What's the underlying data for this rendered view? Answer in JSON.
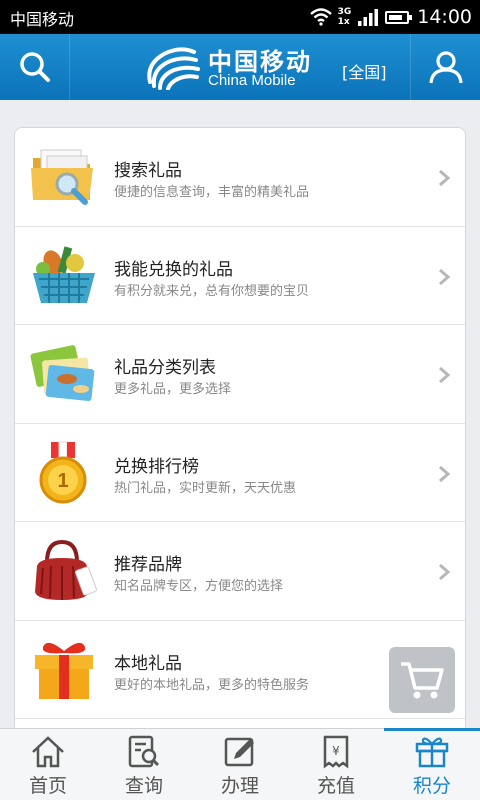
{
  "status": {
    "carrier": "中国移动",
    "network_top": "3G",
    "network_bottom": "1x",
    "battery_level": 0.8,
    "time": "14:00"
  },
  "header": {
    "logo_cn": "中国移动",
    "logo_en": "China Mobile",
    "region": "[全国]",
    "search_icon": "search-icon",
    "user_icon": "user-icon",
    "brand_color": "#1a86c9"
  },
  "menu": [
    {
      "title": "搜索礼品",
      "sub": "便捷的信息查询，丰富的精美礼品",
      "icon": "folder-search-icon"
    },
    {
      "title": "我能兑换的礼品",
      "sub": "有积分就来兑，总有你想要的宝贝",
      "icon": "shopping-basket-icon"
    },
    {
      "title": "礼品分类列表",
      "sub": "更多礼品，更多选择",
      "icon": "category-cards-icon"
    },
    {
      "title": "兑换排行榜",
      "sub": "热门礼品，实时更新，天天优惠",
      "icon": "gold-medal-icon"
    },
    {
      "title": "推荐品牌",
      "sub": "知名品牌专区，方便您的选择",
      "icon": "brand-handbag-icon"
    },
    {
      "title": "本地礼品",
      "sub": "更好的本地礼品，更多的特色服务",
      "icon": "gift-box-icon"
    }
  ],
  "tabs": [
    {
      "label": "首页",
      "icon": "home-icon"
    },
    {
      "label": "查询",
      "icon": "query-icon"
    },
    {
      "label": "办理",
      "icon": "edit-icon"
    },
    {
      "label": "充值",
      "icon": "recharge-icon"
    },
    {
      "label": "积分",
      "icon": "gift-icon",
      "active": true
    }
  ]
}
